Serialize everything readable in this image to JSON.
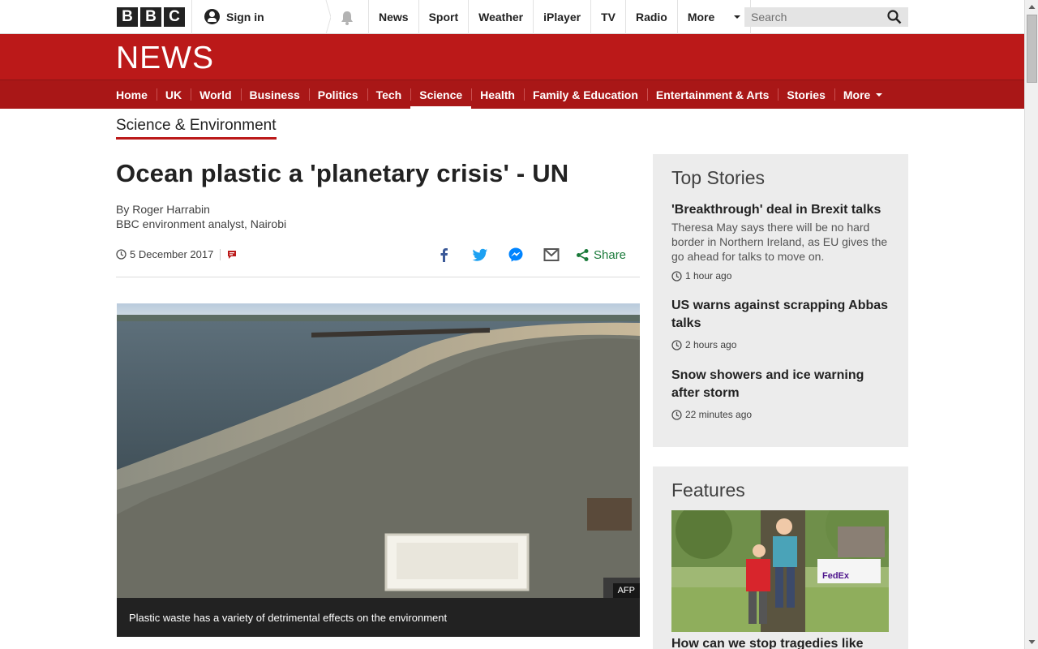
{
  "topbar": {
    "logo_letters": [
      "B",
      "B",
      "C"
    ],
    "signin_label": "Sign in",
    "nav_items": [
      "News",
      "Sport",
      "Weather",
      "iPlayer",
      "TV",
      "Radio",
      "More"
    ],
    "search_placeholder": "Search"
  },
  "masthead": {
    "title": "NEWS"
  },
  "section_nav": {
    "items": [
      "Home",
      "UK",
      "World",
      "Business",
      "Politics",
      "Tech",
      "Science",
      "Health",
      "Family & Education",
      "Entertainment & Arts",
      "Stories",
      "More"
    ],
    "active": "Science"
  },
  "sub_section": "Science & Environment",
  "article": {
    "headline": "Ocean plastic a 'planetary crisis' - UN",
    "byline_name": "By Roger Harrabin",
    "byline_role": "BBC environment analyst, Nairobi",
    "date": "5 December 2017",
    "share_label": "Share",
    "image_credit": "AFP",
    "caption": "Plastic waste has a variety of detrimental effects on the environment"
  },
  "top_stories": {
    "title": "Top Stories",
    "stories": [
      {
        "title": "'Breakthrough' deal in Brexit talks",
        "summary": "Theresa May says there will be no hard border in Northern Ireland, as EU gives the go ahead for talks to move on.",
        "time": "1 hour ago"
      },
      {
        "title": "US warns against scrapping Abbas talks",
        "summary": "",
        "time": "2 hours ago"
      },
      {
        "title": "Snow showers and ice warning after storm",
        "summary": "",
        "time": "22 minutes ago"
      }
    ]
  },
  "features": {
    "title": "Features",
    "first_title": "How can we stop tragedies like",
    "image_sign": "FedEx"
  },
  "colors": {
    "brand_red": "#bb1919",
    "nav_red": "#a91717",
    "share_green": "#1a7a3a"
  },
  "icons": [
    "avatar-icon",
    "bell-icon",
    "search-icon",
    "clock-icon",
    "comment-icon",
    "facebook-icon",
    "twitter-icon",
    "messenger-icon",
    "email-icon",
    "share-icon"
  ]
}
